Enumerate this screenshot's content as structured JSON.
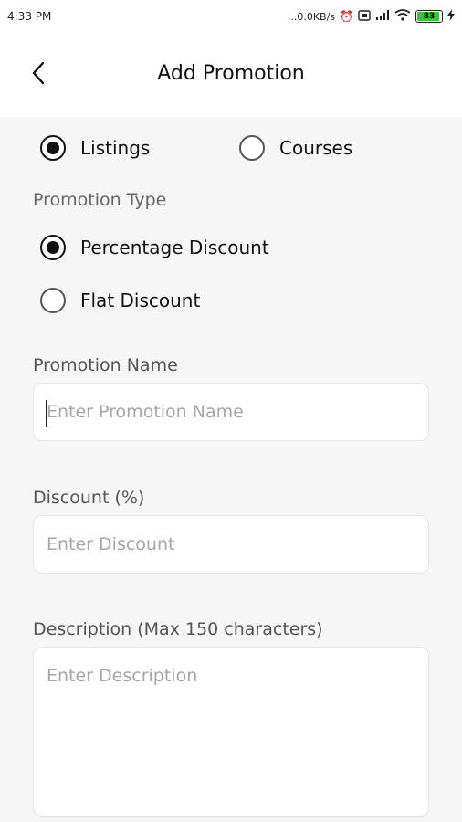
{
  "status_bar": {
    "time": "4:33 PM",
    "network_speed": "...0.0KB/s",
    "battery_level": "83",
    "icons": [
      "alarm-icon",
      "sim-icon",
      "signal-icon",
      "wifi-icon",
      "battery-icon",
      "charging-icon"
    ]
  },
  "header": {
    "title": "Add Promotion",
    "back_icon": "chevron-left-icon"
  },
  "category": {
    "options": [
      {
        "label": "Listings",
        "selected": true
      },
      {
        "label": "Courses",
        "selected": false
      }
    ]
  },
  "promotion_type": {
    "label": "Promotion Type",
    "options": [
      {
        "label": "Percentage Discount",
        "selected": true
      },
      {
        "label": "Flat Discount",
        "selected": false
      }
    ]
  },
  "fields": {
    "promotion_name": {
      "label": "Promotion Name",
      "placeholder": "Enter Promotion Name",
      "value": ""
    },
    "discount": {
      "label": "Discount (%)",
      "placeholder": "Enter Discount",
      "value": ""
    },
    "description": {
      "label": "Description (Max 150 characters)",
      "placeholder": "Enter Description",
      "value": ""
    }
  },
  "colors": {
    "background": "#f6f6f6",
    "surface": "#ffffff",
    "text": "#111111",
    "muted_label": "#666666",
    "placeholder": "#a6a6a6",
    "battery_fill": "#3fbf3f"
  }
}
